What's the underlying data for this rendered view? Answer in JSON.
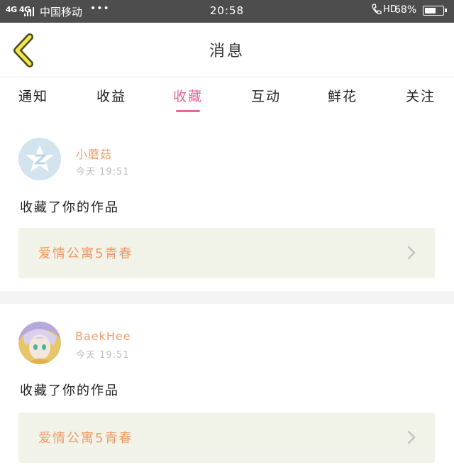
{
  "status_bar": {
    "network": "4G 4G",
    "carrier": "中国移动",
    "more": "•••",
    "time": "20:58",
    "hd": "HD",
    "battery_pct": "68%",
    "battery_level": 0.68
  },
  "header": {
    "title": "消息",
    "back_icon": "chevron-left-icon"
  },
  "tabs": [
    {
      "label": "通知"
    },
    {
      "label": "收益"
    },
    {
      "label": "收藏"
    },
    {
      "label": "互动"
    },
    {
      "label": "鲜花"
    },
    {
      "label": "关注"
    }
  ],
  "active_tab": "收藏",
  "accent_color": "#e8669a",
  "messages": [
    {
      "username": "小蘑菇",
      "timestamp": "今天 19:51",
      "action": "收藏了你的作品",
      "work_title": "爱情公寓5青春",
      "avatar_icon": "default-star-avatar"
    },
    {
      "username": "BaekHee",
      "timestamp": "今天 19:51",
      "action": "收藏了你的作品",
      "work_title": "爱情公寓5青春",
      "avatar_icon": "anime-character-avatar"
    }
  ]
}
